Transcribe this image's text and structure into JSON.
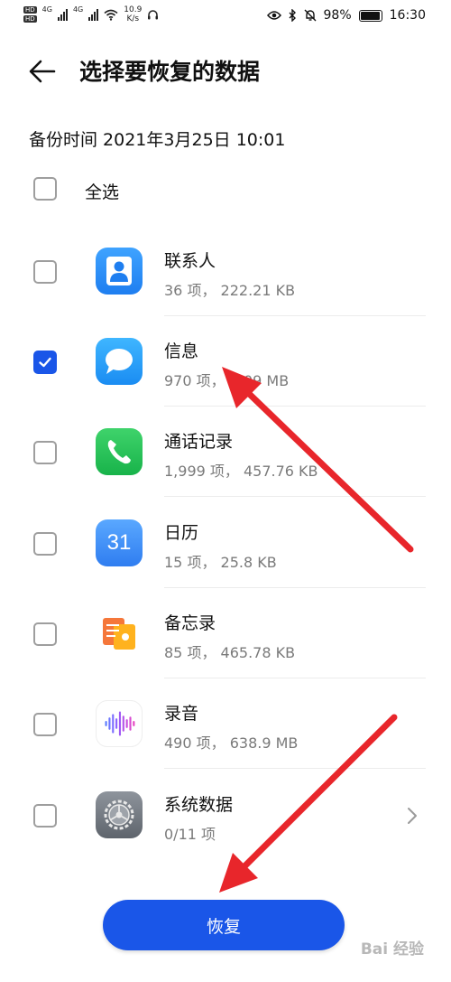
{
  "status_bar": {
    "net_speed_value": "10.9",
    "net_speed_unit": "K/s",
    "hd_badges": [
      "HD",
      "HD"
    ],
    "network_type": "4G",
    "battery": "98%",
    "battery_level": 0.98,
    "time": "16:30"
  },
  "header": {
    "title": "选择要恢复的数据"
  },
  "backup_time": "备份时间 2021年3月25日 10:01",
  "select_all": {
    "label": "全选",
    "checked": false
  },
  "items": [
    {
      "title": "联系人",
      "subtitle": "36 项， 222.21 KB",
      "checked": false,
      "icon": "contacts-icon"
    },
    {
      "title": "信息",
      "subtitle": "970 项， 3.09 MB",
      "checked": true,
      "icon": "messages-icon"
    },
    {
      "title": "通话记录",
      "subtitle": "1,999 项， 457.76 KB",
      "checked": false,
      "icon": "phone-icon"
    },
    {
      "title": "日历",
      "subtitle": "15 项， 25.8 KB",
      "checked": false,
      "icon": "calendar-icon",
      "icon_text": "31"
    },
    {
      "title": "备忘录",
      "subtitle": "85 项， 465.78 KB",
      "checked": false,
      "icon": "notes-icon"
    },
    {
      "title": "录音",
      "subtitle": "490 项， 638.9 MB",
      "checked": false,
      "icon": "recorder-icon"
    },
    {
      "title": "系统数据",
      "subtitle": "0/11 项",
      "checked": false,
      "icon": "settings-gear-icon",
      "has_chevron": true
    }
  ],
  "restore_button": {
    "label": "恢复"
  },
  "watermark": "Bai 经验",
  "colors": {
    "accent": "#1a56e8",
    "annotation_arrow": "#e8262b"
  }
}
